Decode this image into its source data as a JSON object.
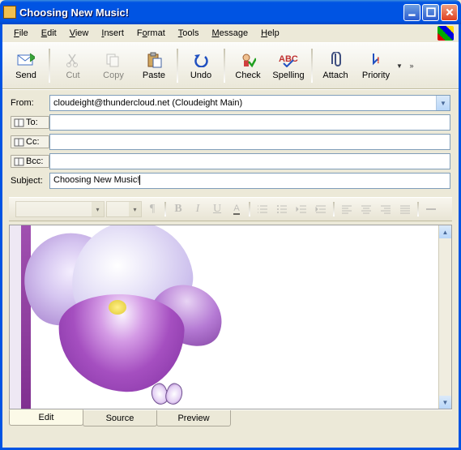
{
  "window": {
    "title": "Choosing New Music!"
  },
  "menu": {
    "file": "File",
    "edit": "Edit",
    "view": "View",
    "insert": "Insert",
    "format": "Format",
    "tools": "Tools",
    "message": "Message",
    "help": "Help"
  },
  "toolbar": {
    "send": "Send",
    "cut": "Cut",
    "copy": "Copy",
    "paste": "Paste",
    "undo": "Undo",
    "check": "Check",
    "spelling": "Spelling",
    "attach": "Attach",
    "priority": "Priority"
  },
  "headers": {
    "from_label": "From:",
    "from_value": "cloudeight@thundercloud.net   (Cloudeight Main)",
    "to_label": "To:",
    "to_value": "",
    "cc_label": "Cc:",
    "cc_value": "",
    "bcc_label": "Bcc:",
    "bcc_value": "",
    "subject_label": "Subject:",
    "subject_value": "Choosing New Music!"
  },
  "format_toolbar": {
    "font_name": "",
    "font_size": "",
    "para_style": "¶",
    "bold": "B",
    "italic": "I",
    "underline": "U",
    "color": "A"
  },
  "tabs": {
    "edit": "Edit",
    "source": "Source",
    "preview": "Preview",
    "active": "edit"
  }
}
